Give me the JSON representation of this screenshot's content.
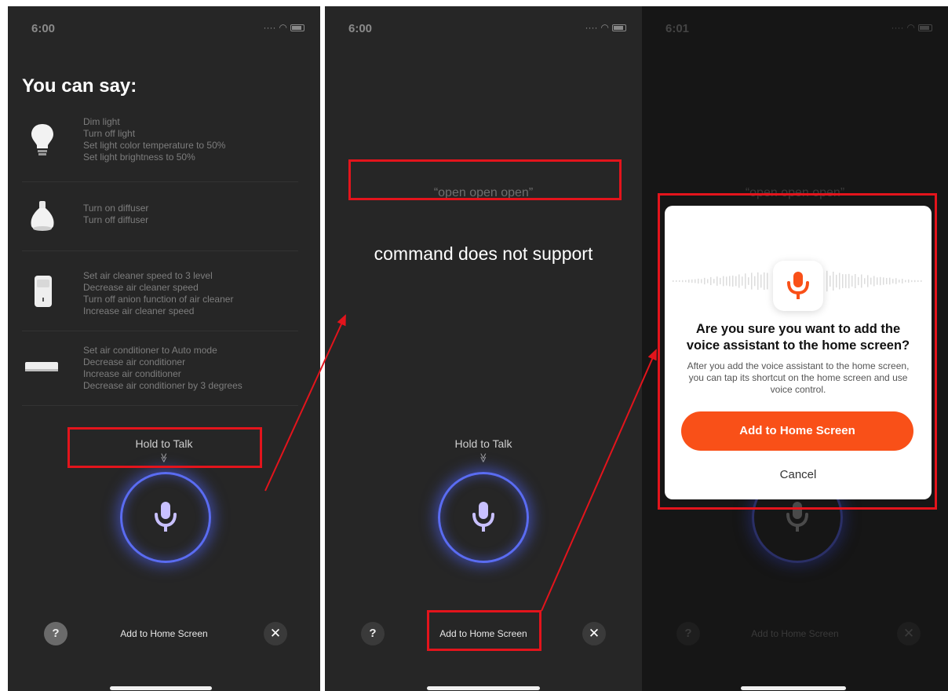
{
  "status": {
    "time_1": "6:00",
    "time_2": "6:00",
    "time_3": "6:01"
  },
  "screen1": {
    "title": "You can say:",
    "groups": [
      {
        "icon": "bulb-icon",
        "lines": [
          "Dim light",
          "Turn off light",
          "Set light color temperature to 50%",
          "Set light brightness to 50%"
        ]
      },
      {
        "icon": "diffuser-icon",
        "lines": [
          "Turn on diffuser",
          "Turn off diffuser"
        ]
      },
      {
        "icon": "air-cleaner-icon",
        "lines": [
          "Set air cleaner speed to 3 level",
          "Decrease air cleaner speed",
          "Turn off anion function of air cleaner",
          "Increase air cleaner speed"
        ]
      },
      {
        "icon": "air-conditioner-icon",
        "lines": [
          "Set air conditioner to Auto mode",
          "Decrease air conditioner",
          "Increase air conditioner",
          "Decrease air conditioner by 3 degrees"
        ]
      }
    ],
    "hold_to_talk": "Hold to Talk",
    "chevron": "≫",
    "help": "?",
    "add_home": "Add to Home Screen",
    "close": "✕"
  },
  "screen2": {
    "recognized": "“open open open”",
    "message": "command does not support",
    "hold_to_talk": "Hold to Talk",
    "chevron": "≫",
    "help": "?",
    "add_home": "Add to Home Screen",
    "close": "✕"
  },
  "screen3": {
    "recognized": "“open open open”",
    "dialog": {
      "title_line1": "Are you sure you want to add the",
      "title_line2": "voice assistant to the home screen?",
      "description": "After you add the voice assistant to the home screen, you can tap its shortcut on the home screen and use voice control.",
      "confirm": "Add to Home Screen",
      "cancel": "Cancel"
    },
    "help": "?",
    "add_home": "Add to Home Screen",
    "close": "✕"
  },
  "colors": {
    "accent": "#f95018",
    "mic_ring": "#5a6cf2",
    "annotation": "#e3141c"
  }
}
